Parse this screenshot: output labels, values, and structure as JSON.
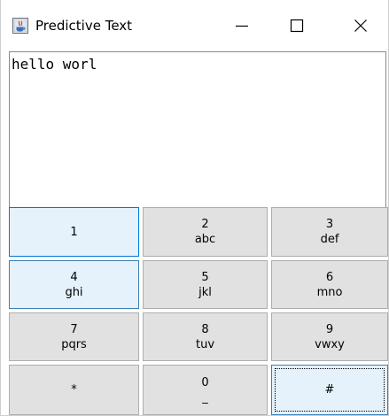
{
  "window": {
    "title": "Predictive Text",
    "app_icon": "java-app-icon",
    "controls": {
      "minimize_icon": "minimize-icon",
      "maximize_icon": "maximize-icon",
      "close_icon": "close-icon"
    }
  },
  "text_area": {
    "value": "hello worl"
  },
  "keypad": {
    "keys": [
      {
        "num": "1",
        "letters": ""
      },
      {
        "num": "2",
        "letters": "abc"
      },
      {
        "num": "3",
        "letters": "def"
      },
      {
        "num": "4",
        "letters": "ghi"
      },
      {
        "num": "5",
        "letters": "jkl"
      },
      {
        "num": "6",
        "letters": "mno"
      },
      {
        "num": "7",
        "letters": "pqrs"
      },
      {
        "num": "8",
        "letters": "tuv"
      },
      {
        "num": "9",
        "letters": "vwxy"
      },
      {
        "num": "*",
        "letters": ""
      },
      {
        "num": "0",
        "letters": "_"
      },
      {
        "num": "#",
        "letters": ""
      }
    ]
  },
  "colors": {
    "key_background": "#e1e1e1",
    "key_hover_background": "#e5f1fb",
    "key_focus_border": "#0078d7"
  }
}
